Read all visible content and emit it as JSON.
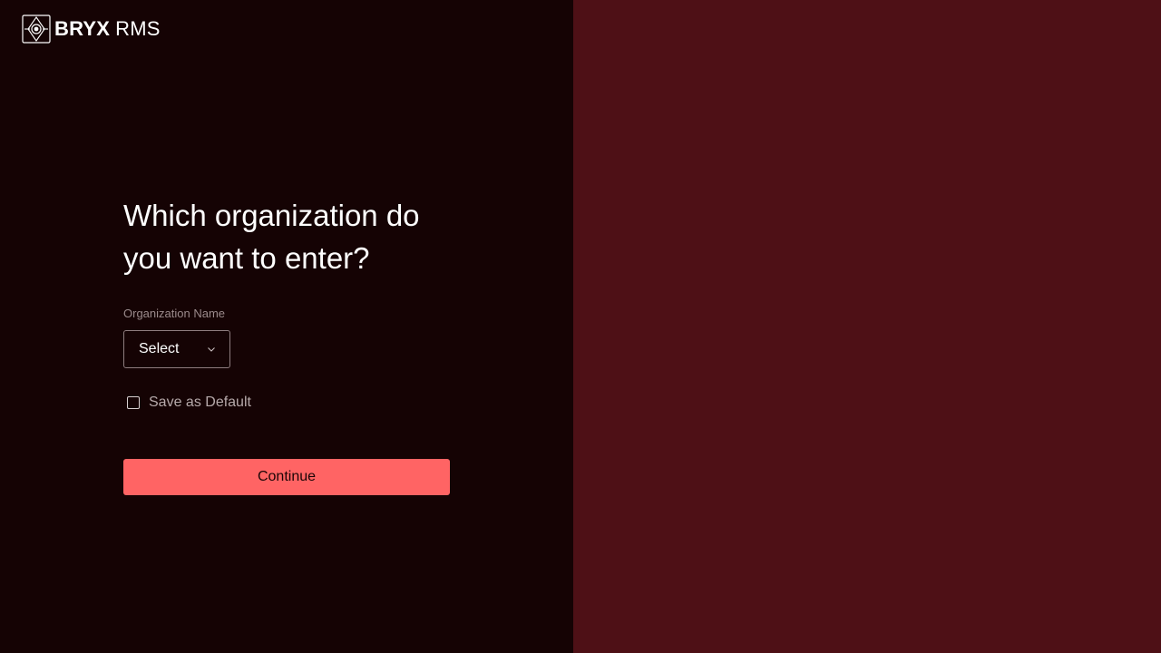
{
  "brand": {
    "name_bold": "BRYX",
    "name_light": "RMS",
    "logo_icon": "bryx-compass-logo-icon"
  },
  "form": {
    "heading": "Which organization do you want to enter?",
    "org_label": "Organization Name",
    "org_select_value": "Select",
    "chevron_icon": "chevron-down-icon",
    "save_default_label": "Save as Default",
    "save_default_checked": false,
    "continue_label": "Continue"
  },
  "colors": {
    "left_background": "#150304",
    "right_background": "#4e1016",
    "accent": "#ff6464",
    "text_primary": "#ffffff",
    "text_muted": "#9a8a8b"
  }
}
